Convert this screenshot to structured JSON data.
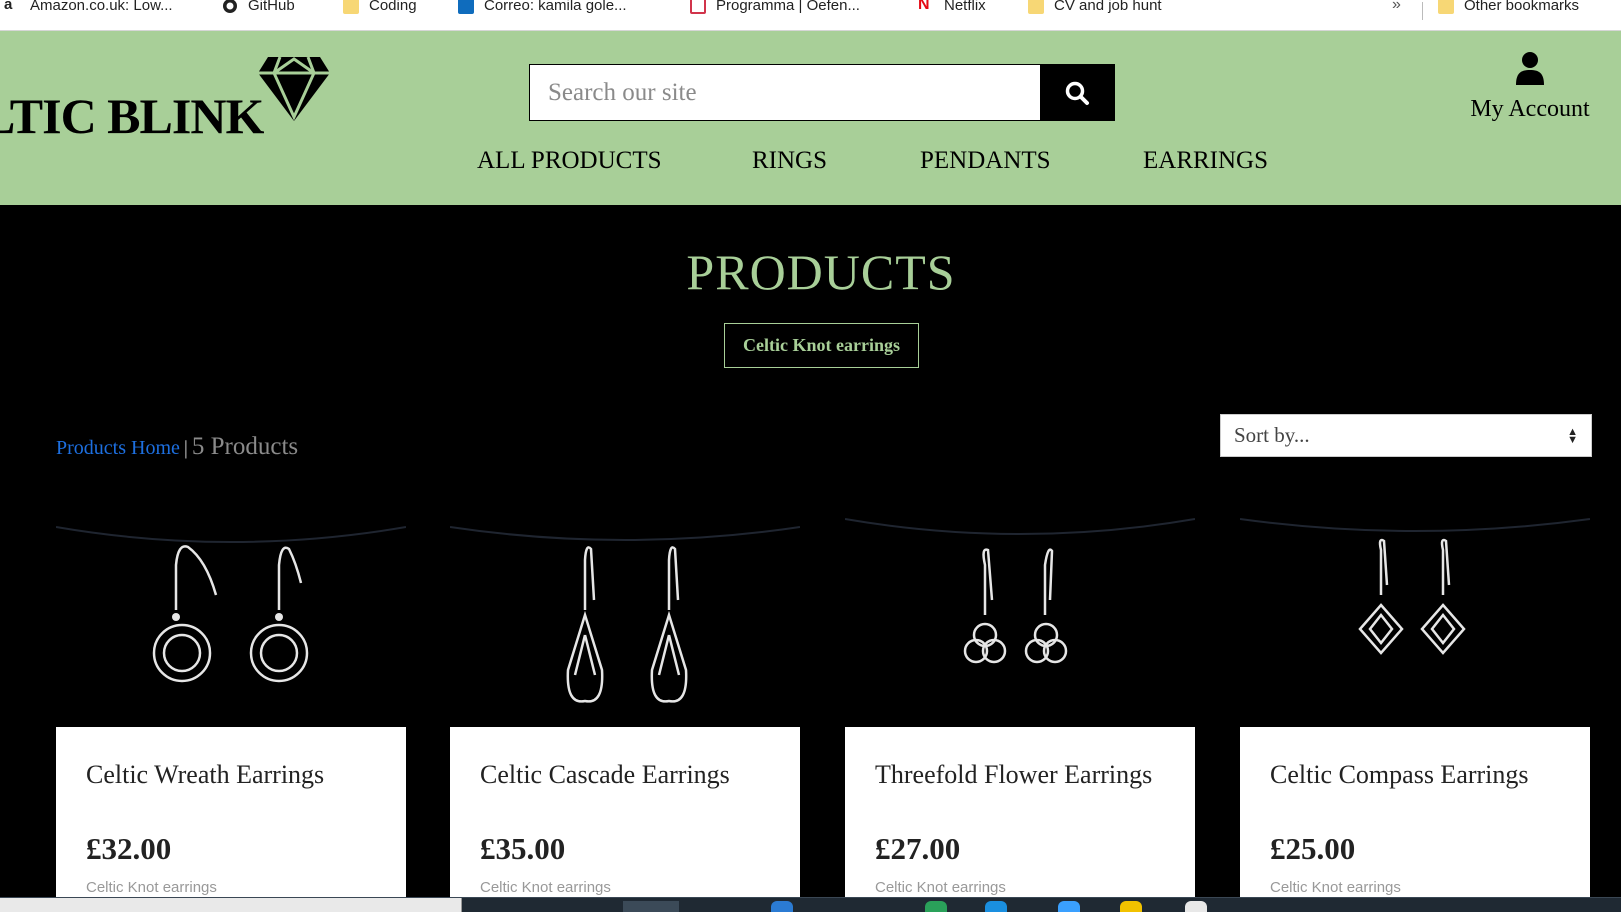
{
  "bookmarks": {
    "items": [
      {
        "label": "Amazon.co.uk: Low...",
        "icon": "amazon-icon"
      },
      {
        "label": "GitHub",
        "icon": "github-icon"
      },
      {
        "label": "Coding",
        "icon": "folder-icon"
      },
      {
        "label": "Correo: kamila gole...",
        "icon": "outlook-icon"
      },
      {
        "label": "Programma | Oefen...",
        "icon": "bookmark-icon"
      },
      {
        "label": "Netflix",
        "icon": "netflix-icon"
      },
      {
        "label": "CV and job hunt",
        "icon": "folder-icon"
      }
    ],
    "overflow": "»",
    "other": "Other bookmarks"
  },
  "header": {
    "logo_text": "LTIC BLINK",
    "search_placeholder": "Search our site",
    "account_label": "My Account",
    "nav": [
      "ALL PRODUCTS",
      "RINGS",
      "PENDANTS",
      "EARRINGS"
    ]
  },
  "main": {
    "title": "PRODUCTS",
    "tag": "Celtic Knot earrings",
    "breadcrumb_home": "Products Home",
    "breadcrumb_sep": "|",
    "product_count": "5 Products",
    "sort_label": "Sort by..."
  },
  "products": [
    {
      "name": "Celtic Wreath Earrings",
      "price": "£32.00",
      "category": "Celtic Knot earrings"
    },
    {
      "name": "Celtic Cascade Earrings",
      "price": "£35.00",
      "category": "Celtic Knot earrings"
    },
    {
      "name": "Threefold Flower Earrings",
      "price": "£27.00",
      "category": "Celtic Knot earrings"
    },
    {
      "name": "Celtic Compass Earrings",
      "price": "£25.00",
      "category": "Celtic Knot earrings"
    }
  ],
  "colors": {
    "header_bg": "#a8cf98",
    "accent": "#a8cf98",
    "link": "#1d6fe0",
    "page_bg": "#000000"
  }
}
